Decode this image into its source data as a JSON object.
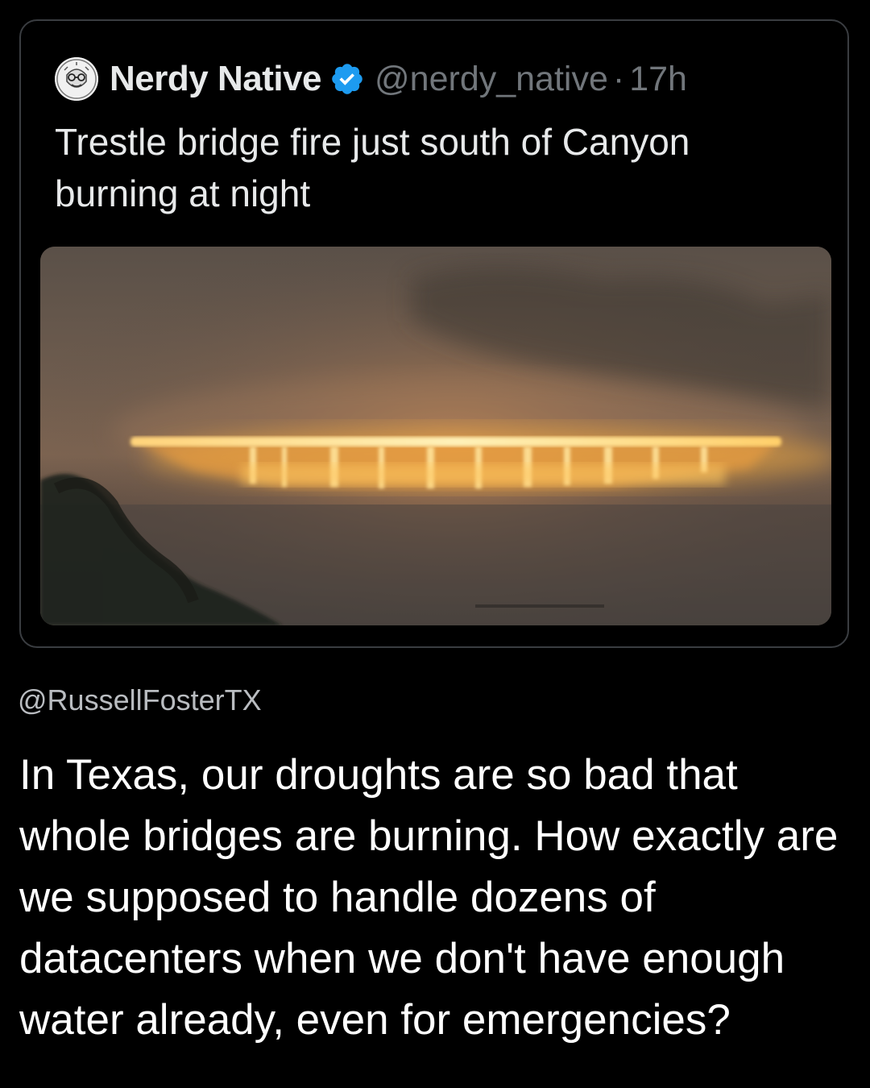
{
  "quoted_tweet": {
    "display_name": "Nerdy Native",
    "verified": true,
    "handle": "@nerdy_native",
    "separator": "·",
    "timestamp": "17h",
    "text": "Trestle bridge fire just south of Canyon burning at night",
    "media_description_icon": "photo-icon",
    "avatar_icon": "avatar-icon"
  },
  "attribution": "@RussellFosterTX",
  "body_text": "In Texas, our droughts are so bad that whole bridges are burning. How exactly are we supposed to handle dozens of datacenters when we don't have enough water already, even for emergencies?",
  "colors": {
    "background": "#000000",
    "verified_blue": "#1d9bf0",
    "secondary_text": "#71767b",
    "card_border": "#3a3d41",
    "fire": "#ffb23a"
  }
}
